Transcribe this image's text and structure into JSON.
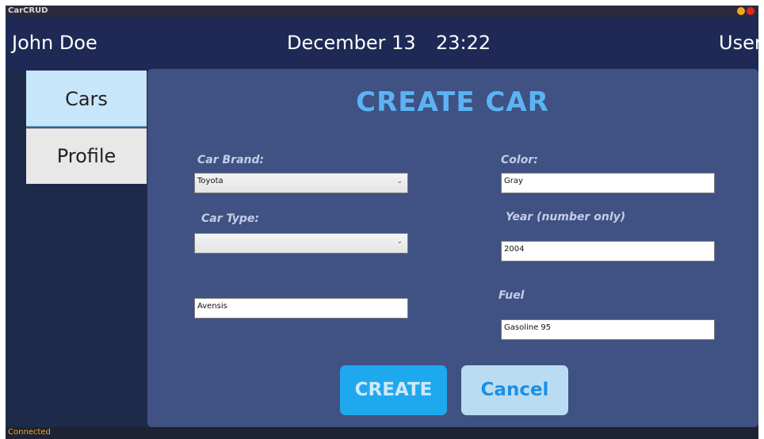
{
  "window": {
    "title": "CarCRUD"
  },
  "header": {
    "user_name": "John Doe",
    "date": "December 13",
    "time": "23:22",
    "role": "User"
  },
  "sidebar": {
    "items": [
      {
        "label": "Cars",
        "active": true
      },
      {
        "label": "Profile",
        "active": false
      }
    ]
  },
  "form": {
    "title": "CREATE CAR",
    "brand": {
      "label": "Car Brand:",
      "value": "Toyota"
    },
    "type": {
      "label": "Car Type:",
      "value": ""
    },
    "model": {
      "value": "Avensis"
    },
    "color": {
      "label": "Color:",
      "value": "Gray"
    },
    "year": {
      "label": "Year (number only)",
      "value": "2004"
    },
    "fuel": {
      "label": "Fuel",
      "value": "Gasoline 95"
    },
    "create_label": "CREATE",
    "cancel_label": "Cancel"
  },
  "status": {
    "text": "Connected"
  },
  "colors": {
    "accent": "#5cb3f4",
    "create_button": "#1ea9ef",
    "cancel_button": "#b9dcf3",
    "status_text": "#f0a81e"
  }
}
